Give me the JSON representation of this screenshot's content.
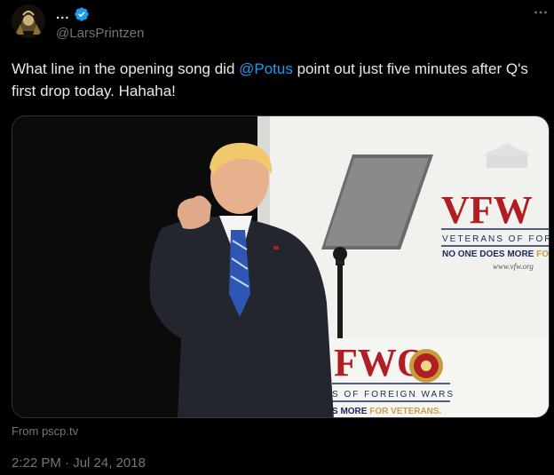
{
  "author": {
    "display_name": "...",
    "handle": "@LarsPrintzen"
  },
  "tweet": {
    "text_before": "What line in the opening song did ",
    "mention": "@Potus",
    "text_after": " point out just five minutes after Q's first drop today. Hahaha!"
  },
  "media": {
    "logo_main": "VFW",
    "logo_subtitle": "VETERANS OF FOREI",
    "slogan_left": "NO ONE DOES MORE ",
    "slogan_right": "FOR",
    "url": "www.vfw.org",
    "podium_logo": "FWO",
    "podium_subtitle": "S OF FOREIGN WARS",
    "podium_slogan_left": "S MORE ",
    "podium_slogan_right": "FOR VETERANS."
  },
  "card_source": "From pscp.tv",
  "timestamp": {
    "time": "2:22 PM",
    "separator": " · ",
    "date": "Jul 24, 2018"
  },
  "colors": {
    "background": "#000000",
    "text": "#e7e9ea",
    "muted": "#71767b",
    "accent": "#1d9bf0",
    "vfw_red": "#b01e23"
  }
}
